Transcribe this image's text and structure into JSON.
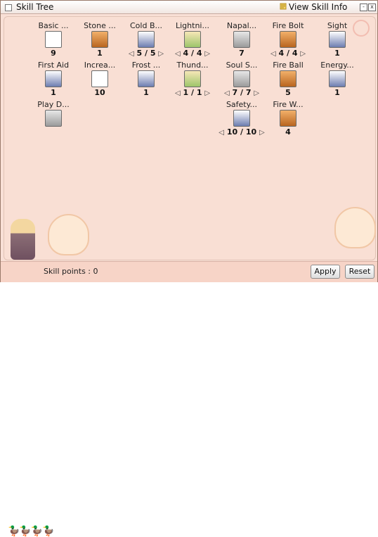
{
  "window": {
    "title": "Skill Tree",
    "view_info_label": "View Skill Info",
    "min_label": "-",
    "close_label": "x"
  },
  "skills": [
    {
      "name": "Basic ...",
      "level": "9",
      "icon": "cloud-icon"
    },
    {
      "name": "Stone ...",
      "level": "1",
      "icon": "stone-scroll-icon"
    },
    {
      "name": "Cold B...",
      "level": "5 / 5",
      "icon": "ice-bolt-icon"
    },
    {
      "name": "Lightni...",
      "level": "4 / 4",
      "icon": "lightning-scroll-icon"
    },
    {
      "name": "Napal...",
      "level": "7",
      "icon": "napalm-icon"
    },
    {
      "name": "Fire Bolt",
      "level": "4 / 4",
      "icon": "fire-bolt-icon"
    },
    {
      "name": "Sight",
      "level": "1",
      "icon": "sight-icon"
    },
    {
      "name": "First Aid",
      "level": "1",
      "icon": "first-aid-icon"
    },
    {
      "name": "Increa...",
      "level": "10",
      "icon": "increase-sp-icon"
    },
    {
      "name": "Frost ...",
      "level": "1",
      "icon": "frost-icon"
    },
    {
      "name": "Thund...",
      "level": "1 / 1",
      "icon": "thunder-icon"
    },
    {
      "name": "Soul S...",
      "level": "7 / 7",
      "icon": "soul-strike-icon"
    },
    {
      "name": "Fire Ball",
      "level": "5",
      "icon": "fire-ball-icon"
    },
    {
      "name": "Energy...",
      "level": "1",
      "icon": "energy-icon"
    },
    {
      "name": "Play D...",
      "level": "",
      "icon": "play-dead-icon"
    },
    {
      "name": "Safety...",
      "level": "10 / 10",
      "icon": "safety-wall-icon"
    },
    {
      "name": "Fire W...",
      "level": "4",
      "icon": "fire-wall-icon"
    }
  ],
  "footer": {
    "skill_points_label": "Skill points : 0",
    "apply_label": "Apply",
    "reset_label": "Reset"
  }
}
